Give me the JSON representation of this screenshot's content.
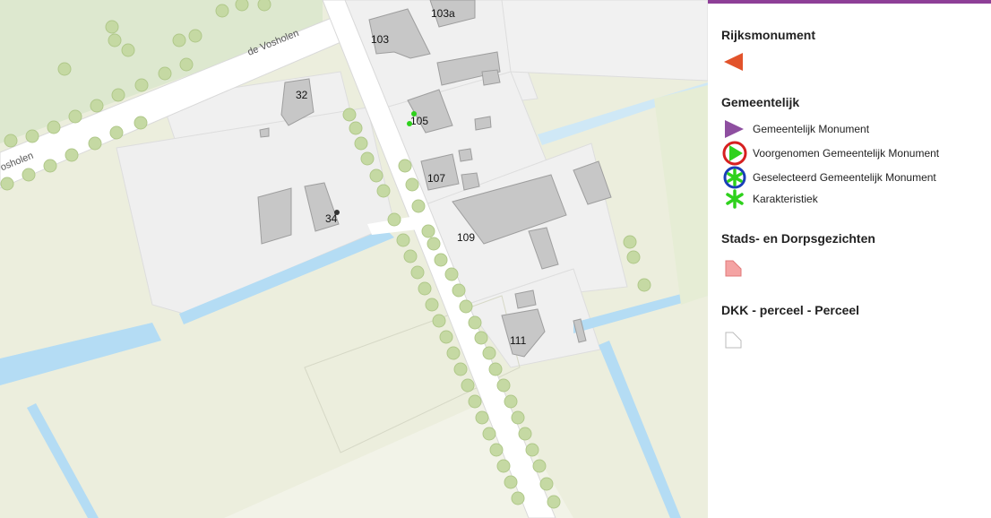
{
  "map": {
    "road_names": [
      "de Vosholen",
      "Vosholen"
    ],
    "house_numbers": [
      "103a",
      "103",
      "32",
      "105",
      "107",
      "34",
      "109",
      "111"
    ]
  },
  "legend": {
    "accent_color": "#8e3f97",
    "sections": [
      {
        "title": "Rijksmonument",
        "items": [
          {
            "label": "",
            "icon": "orange-triangle-icon",
            "color": "#e2532b"
          }
        ]
      },
      {
        "title": "Gemeentelijk",
        "items": [
          {
            "label": "Gemeentelijk Monument",
            "icon": "purple-triangle-icon",
            "color": "#8e4fa0"
          },
          {
            "label": "Voorgenomen Gemeentelijk Monument",
            "icon": "green-triangle-red-ring-icon",
            "color": "#2ed11c"
          },
          {
            "label": "Geselecteerd Gemeentelijk Monument",
            "icon": "green-asterisk-blue-ring-icon",
            "color": "#1a3fb8"
          },
          {
            "label": "Karakteristiek",
            "icon": "green-asterisk-icon",
            "color": "#2ed11c"
          }
        ]
      },
      {
        "title": "Stads- en Dorpsgezichten",
        "items": [
          {
            "label": "",
            "icon": "pink-polygon-icon",
            "color": "#f4a3a3"
          }
        ]
      },
      {
        "title": "DKK - perceel - Perceel",
        "items": [
          {
            "label": "",
            "icon": "white-polygon-icon",
            "color": "#ffffff"
          }
        ]
      }
    ]
  }
}
